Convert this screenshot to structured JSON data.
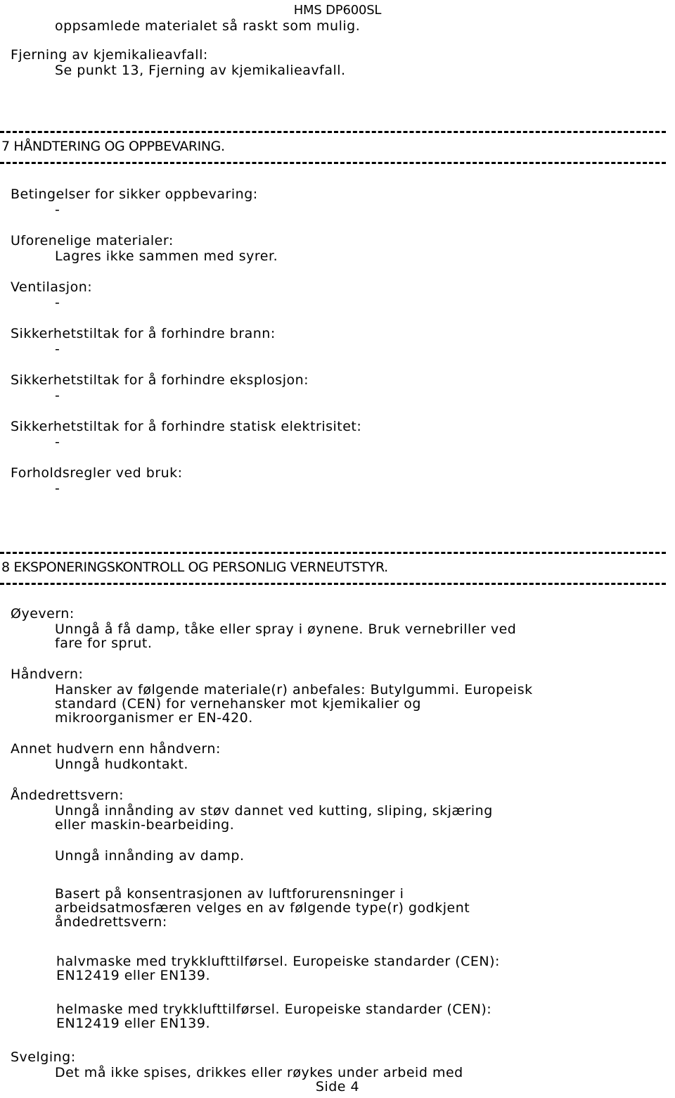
{
  "document": {
    "header_title": "HMS DP600SL",
    "footer_page": "Side 4",
    "placeholder_dash": "-"
  },
  "top_continuation": {
    "line1": "oppsamlede materialet så raskt som mulig.",
    "heading": "Fjerning av kjemikalieavfall:",
    "body": "Se punkt 13, Fjerning av kjemikalieavfall."
  },
  "section7": {
    "title": "7 HÅNDTERING OG OPPBEVARING.",
    "blocks": [
      {
        "heading": "Betingelser for sikker oppbevaring:",
        "body": "-"
      },
      {
        "heading": "Uforenelige materialer:",
        "body": "Lagres ikke sammen med syrer."
      },
      {
        "heading": "Ventilasjon:",
        "body": "-"
      },
      {
        "heading": "Sikkerhetstiltak for å forhindre brann:",
        "body": "-"
      },
      {
        "heading": "Sikkerhetstiltak for å forhindre eksplosjon:",
        "body": "-"
      },
      {
        "heading": "Sikkerhetstiltak for å forhindre statisk elektrisitet:",
        "body": "-"
      },
      {
        "heading": "Forholdsregler ved bruk:",
        "body": "-"
      }
    ]
  },
  "section8": {
    "title": "8 EKSPONERINGSKONTROLL OG PERSONLIG VERNEUTSTYR.",
    "eye": {
      "heading": "Øyevern:",
      "body_line1": "Unngå å få damp, tåke eller spray i øynene. Bruk vernebriller ved",
      "body_line2": "fare for sprut."
    },
    "hand": {
      "heading": "Håndvern:",
      "body_line1": "Hansker av følgende materiale(r) anbefales: Butylgummi. Europeisk",
      "body_line2": "standard (CEN) for vernehansker mot kjemikalier og",
      "body_line3": "mikroorganismer er EN-420."
    },
    "skin": {
      "heading": "Annet hudvern enn håndvern:",
      "body": "Unngå hudkontakt."
    },
    "respiratory": {
      "heading": "Åndedrettsvern:",
      "body_line1": "Unngå innånding av støv dannet ved kutting, sliping, skjæring",
      "body_line2": "eller maskin-bearbeiding.",
      "body_line3": "Unngå innånding av damp.",
      "body_line4": "Basert på konsentrasjonen av luftforurensninger i",
      "body_line5": "arbeidsatmosfæren velges en av følgende type(r) godkjent",
      "body_line6": "åndedrettsvern:",
      "option1_line1": "halvmaske med trykklufttilførsel. Europeiske standarder (CEN):",
      "option1_line2": "EN12419 eller EN139.",
      "option2_line1": "helmaske med trykklufttilførsel. Europeiske standarder (CEN):",
      "option2_line2": "EN12419 eller EN139."
    },
    "ingestion": {
      "heading": "Svelging:",
      "body": "Det må ikke spises, drikkes eller røykes under arbeid med"
    }
  }
}
